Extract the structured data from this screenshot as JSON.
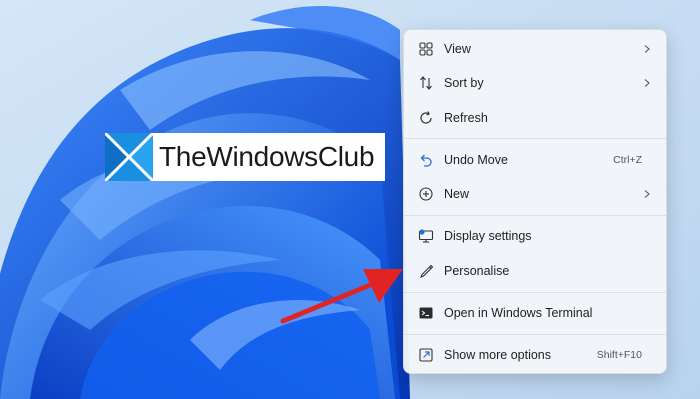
{
  "watermark": {
    "text": "TheWindowsClub"
  },
  "context_menu": {
    "items": [
      {
        "label": "View",
        "icon": "grid-view-icon",
        "submenu": true
      },
      {
        "label": "Sort by",
        "icon": "sort-arrows-icon",
        "submenu": true
      },
      {
        "label": "Refresh",
        "icon": "refresh-icon",
        "submenu": false
      },
      {
        "label": "Undo Move",
        "icon": "undo-icon",
        "shortcut": "Ctrl+Z"
      },
      {
        "label": "New",
        "icon": "plus-circle-icon",
        "submenu": true
      },
      {
        "label": "Display settings",
        "icon": "display-settings-icon"
      },
      {
        "label": "Personalise",
        "icon": "brush-pen-icon"
      },
      {
        "label": "Open in Windows Terminal",
        "icon": "terminal-icon"
      },
      {
        "label": "Show more options",
        "icon": "show-more-options-icon",
        "shortcut": "Shift+F10"
      }
    ]
  },
  "colors": {
    "wallpaper_light": "#c9dff2",
    "wallpaper_blue": "#0a5de8",
    "wallpaper_deep": "#0236b8",
    "menu_bg": "#f3f6fa",
    "accent": "#0067c0",
    "annotation_arrow": "#e02424"
  }
}
